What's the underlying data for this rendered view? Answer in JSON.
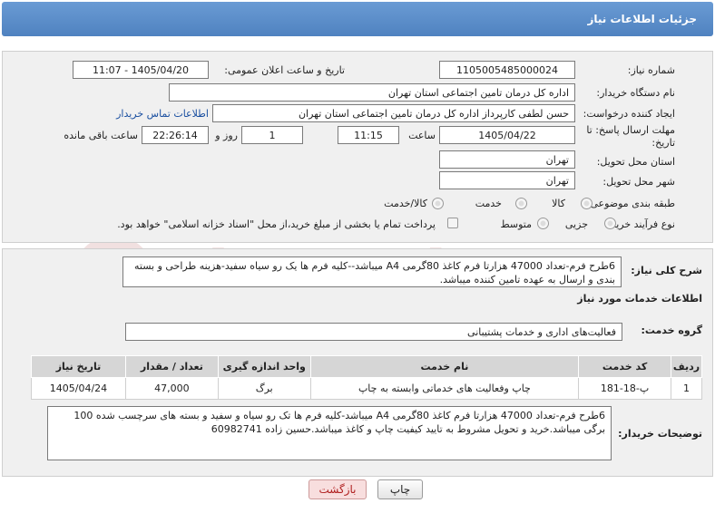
{
  "header": {
    "title": "جزئیات اطلاعات نیاز"
  },
  "fields": {
    "need_number_label": "شماره نیاز:",
    "need_number": "1105005485000024",
    "announce_label": "تاریخ و ساعت اعلان عمومی:",
    "announce_value": "1405/04/20 - 11:07",
    "buyer_org_label": "نام دستگاه خریدار:",
    "buyer_org": "اداره کل درمان تامین اجتماعی استان تهران",
    "creator_label": "ایجاد کننده درخواست:",
    "creator": "حسن لطفی کارپرداز اداره کل درمان تامین اجتماعی استان تهران",
    "buyer_contact_link": "اطلاعات تماس خریدار",
    "deadline_label": "مهلت ارسال پاسخ: تا تاریخ:",
    "deadline_date": "1405/04/22",
    "time_label": "ساعت",
    "deadline_time": "11:15",
    "days_value": "1",
    "days_label": "روز و",
    "remaining_time": "22:26:14",
    "remaining_label": "ساعت باقی مانده",
    "province_label": "استان محل تحویل:",
    "province": "تهران",
    "city_label": "شهر محل تحویل:",
    "city": "تهران",
    "category_label": "طبقه بندی موضوعی:",
    "category_options": [
      "کالا",
      "خدمت",
      "کالا/خدمت"
    ],
    "process_label": "نوع فرآیند خرید :",
    "process_options": [
      "جزیی",
      "متوسط"
    ],
    "payment_note": "پرداخت تمام یا بخشی از مبلغ خرید،از محل \"اسناد خزانه اسلامی\" خواهد بود."
  },
  "description": {
    "label": "شرح کلی نیاز:",
    "text": "6طرح فرم-تعداد 47000 هزارتا فرم کاغذ 80گرمی A4 میباشد--کلیه فرم ها یک رو سیاه سفید-هزینه طراحی و بسته بندی و ارسال به عهده تامین کننده میباشد."
  },
  "services": {
    "section_title": "اطلاعات خدمات مورد نیاز",
    "group_label": "گروه خدمت:",
    "group_value": "فعالیت‌های اداری و خدمات پشتیبانی",
    "columns": [
      "ردیف",
      "کد خدمت",
      "نام خدمت",
      "واحد اندازه گیری",
      "تعداد / مقدار",
      "تاریخ نیاز"
    ],
    "rows": [
      [
        "1",
        "پ-18-181",
        "چاپ وفعالیت های خدماتی وابسته به چاپ",
        "برگ",
        "47,000",
        "1405/04/24"
      ]
    ]
  },
  "buyer_notes": {
    "label": "توضیحات خریدار:",
    "text": "6طرح فرم-تعداد 47000 هزارتا فرم کاغذ 80گرمی A4 میباشد-کلیه فرم ها تک رو سیاه و سفید و بسته های سرچسب شده 100 برگی میباشد.خرید و تحویل مشروط به تایید کیفیت چاپ و کاغذ میباشد.حسین زاده 60982741"
  },
  "buttons": {
    "print": "چاپ",
    "back": "بازگشت"
  },
  "watermark": {
    "text": "AriaTender.neT"
  },
  "colors": {
    "header": "#5a8cc9",
    "link": "#1a4fa0",
    "back_button_bg": "#f8dede"
  }
}
